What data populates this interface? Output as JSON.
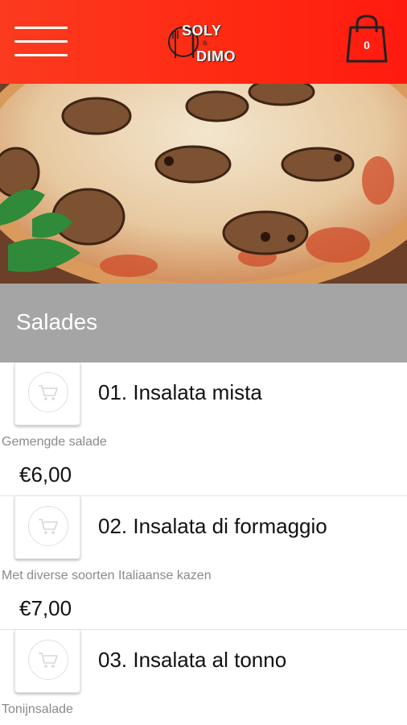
{
  "header": {
    "menu_icon": "hamburger-menu-icon",
    "logo": {
      "line1": "SOLY",
      "amp": "&",
      "line2": "DIMO"
    },
    "cart": {
      "icon": "shopping-bag-icon",
      "count": "0"
    },
    "background_color": "#ff2a12"
  },
  "hero": {
    "image": "pizza-with-mushrooms"
  },
  "section": {
    "title": "Salades",
    "background_color": "#a5a5a5"
  },
  "items": [
    {
      "name": "01. Insalata mista",
      "description": "Gemengde salade",
      "price": "€6,00",
      "icon": "cart-icon"
    },
    {
      "name": "02. Insalata di formaggio",
      "description": "Met diverse soorten Italiaanse kazen",
      "price": "€7,00",
      "icon": "cart-icon"
    },
    {
      "name": "03. Insalata al tonno",
      "description": "Tonijnsalade",
      "icon": "cart-icon"
    }
  ]
}
